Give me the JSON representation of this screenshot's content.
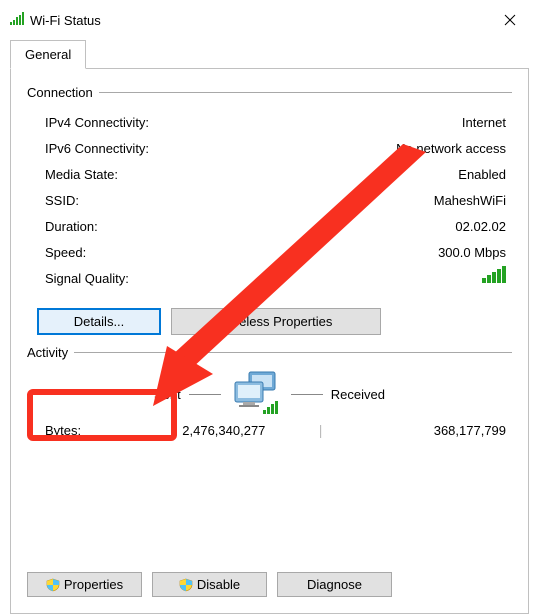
{
  "window": {
    "title": "Wi-Fi Status",
    "tab_label": "General"
  },
  "connection": {
    "header": "Connection",
    "props": {
      "ipv4_k": "IPv4 Connectivity:",
      "ipv4_v": "Internet",
      "ipv6_k": "IPv6 Connectivity:",
      "ipv6_v": "No network access",
      "media_k": "Media State:",
      "media_v": "Enabled",
      "ssid_k": "SSID:",
      "ssid_v": "MaheshWiFi",
      "dur_k": "Duration:",
      "dur_v": "02.02.02",
      "speed_k": "Speed:",
      "speed_v": "300.0 Mbps",
      "sigq_k": "Signal Quality:"
    },
    "buttons": {
      "details": "Details...",
      "wireless_props": "Wireless Properties"
    }
  },
  "activity": {
    "header": "Activity",
    "sent_label": "Sent",
    "received_label": "Received",
    "bytes_label": "Bytes:",
    "sent_bytes": "2,476,340,277",
    "received_bytes": "368,177,799"
  },
  "bottom_buttons": {
    "properties": "Properties",
    "disable": "Disable",
    "diagnose": "Diagnose"
  }
}
